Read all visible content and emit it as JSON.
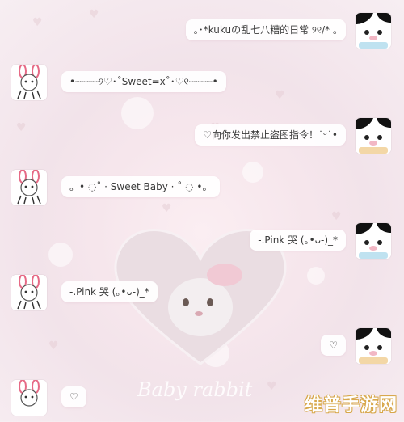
{
  "messages": [
    {
      "side": "right",
      "text": "｡･*kukuの乱七八糟的日常 ୨୧/* ｡"
    },
    {
      "side": "left",
      "text": "•┈┈┈┈୨♡･˚Sweet=x˚･♡୧┈┈┈┈•"
    },
    {
      "side": "right",
      "text": "♡向你发出禁止盗图指令！˙ᵕ˙•"
    },
    {
      "side": "left",
      "text": "。• ◌˚ · Sweet Baby · ˚ ◌ •。"
    },
    {
      "side": "right",
      "text": "-.Pink 哭 (｡•ᴗ-)_*"
    },
    {
      "side": "left",
      "text": "-.Pink 哭 (｡•ᴗ-)_*"
    },
    {
      "side": "right",
      "text": "♡"
    },
    {
      "side": "left",
      "text": "♡"
    }
  ],
  "background_caption": "Baby rabbit",
  "watermark": "维普手游网",
  "colors": {
    "background": "#f4e6ec",
    "bubble": "#ffffff",
    "watermark_outline": "#d7a74a"
  },
  "icons": {
    "left_avatar": "bunny-sticker-icon",
    "right_avatar": "panda-cow-sticker-icon"
  }
}
